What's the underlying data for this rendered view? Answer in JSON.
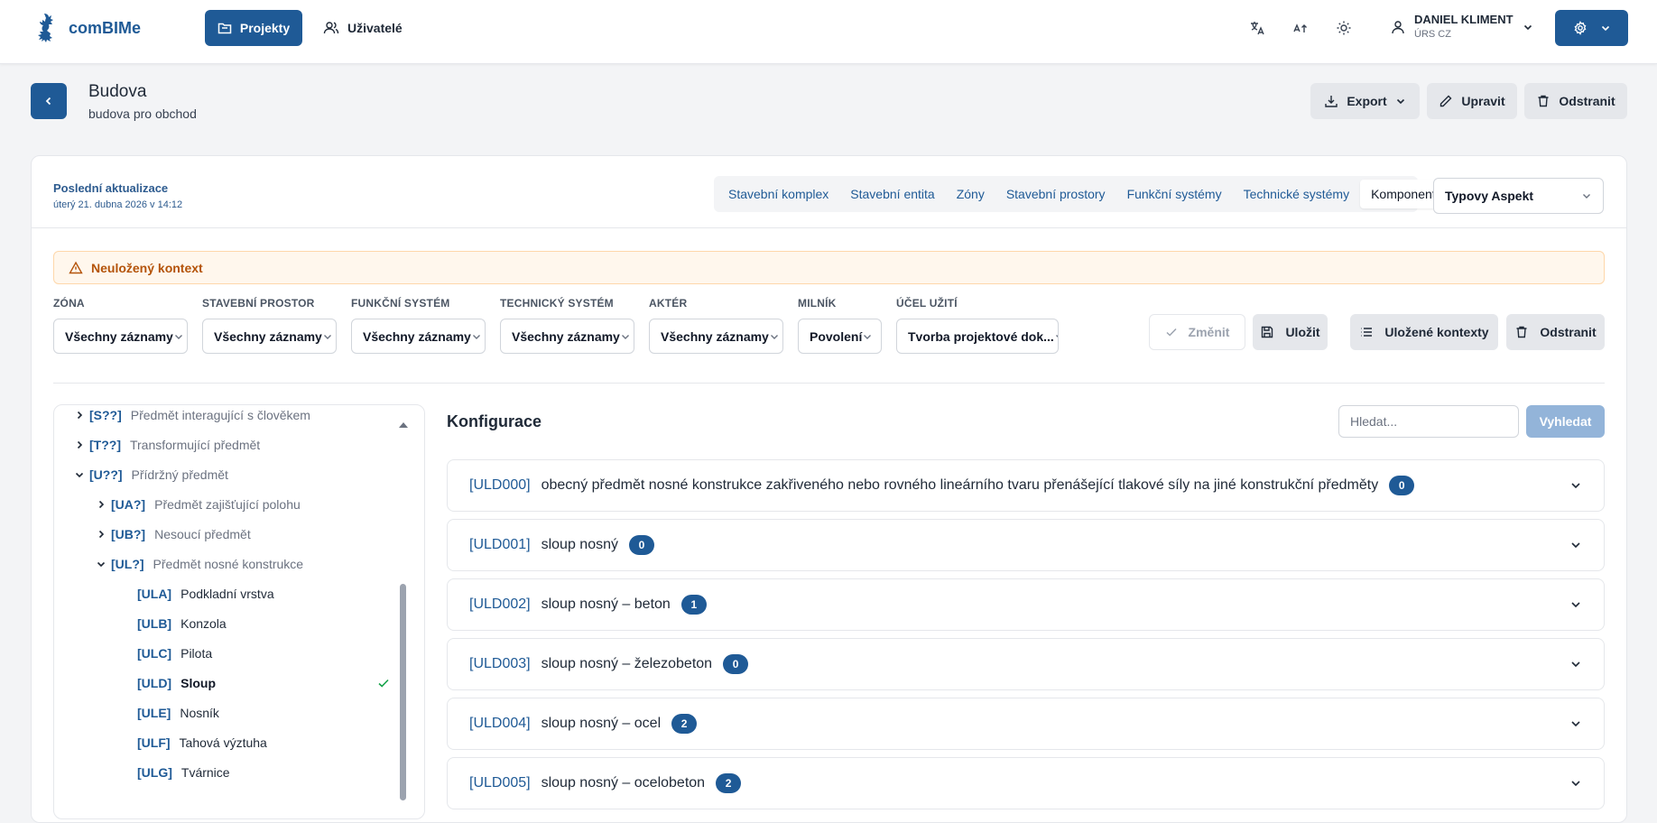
{
  "app": {
    "name": "comBIMe"
  },
  "nav": {
    "projects": "Projekty",
    "users": "Uživatelé"
  },
  "user": {
    "name": "DANIEL KLIMENT",
    "org": "ÚRS CZ"
  },
  "page": {
    "title": "Budova",
    "subtitle": "budova pro obchod"
  },
  "header_actions": {
    "export": "Export",
    "edit": "Upravit",
    "delete": "Odstranit"
  },
  "last_update": {
    "label": "Poslední aktualizace",
    "value": "úterý 21. dubna 2026 v 14:12"
  },
  "tabs": [
    {
      "label": "Stavební komplex"
    },
    {
      "label": "Stavební entita"
    },
    {
      "label": "Zóny"
    },
    {
      "label": "Stavební prostory"
    },
    {
      "label": "Funkční systémy"
    },
    {
      "label": "Technické systémy"
    },
    {
      "label": "Komponenty"
    }
  ],
  "active_tab": "Komponenty",
  "aspect_select": "Typovy Aspekt",
  "alert": "Neuložený kontext",
  "filters": [
    {
      "label": "ZÓNA",
      "value": "Všechny záznamy"
    },
    {
      "label": "STAVEBNÍ PROSTOR",
      "value": "Všechny záznamy"
    },
    {
      "label": "FUNKČNÍ SYSTÉM",
      "value": "Všechny záznamy"
    },
    {
      "label": "TECHNICKÝ SYSTÉM",
      "value": "Všechny záznamy"
    },
    {
      "label": "AKTÉR",
      "value": "Všechny záznamy"
    },
    {
      "label": "MILNÍK",
      "value": "Povolení"
    },
    {
      "label": "ÚČEL UŽITÍ",
      "value": "Tvorba projektové dok..."
    }
  ],
  "filter_actions": {
    "change": "Změnit",
    "save": "Uložit",
    "saved": "Uložené kontexty",
    "delete": "Odstranit"
  },
  "tree": [
    {
      "code": "[S??]",
      "label": "Předmět interagující s člověkem"
    },
    {
      "code": "[T??]",
      "label": "Transformující předmět"
    },
    {
      "code": "[U??]",
      "label": "Přídržný předmět"
    },
    {
      "code": "[UA?]",
      "label": "Předmět zajišťující polohu"
    },
    {
      "code": "[UB?]",
      "label": "Nesoucí předmět"
    },
    {
      "code": "[UL?]",
      "label": "Předmět nosné konstrukce"
    },
    {
      "code": "[ULA]",
      "label": "Podkladní vrstva"
    },
    {
      "code": "[ULB]",
      "label": "Konzola"
    },
    {
      "code": "[ULC]",
      "label": "Pilota"
    },
    {
      "code": "[ULD]",
      "label": "Sloup"
    },
    {
      "code": "[ULE]",
      "label": "Nosník"
    },
    {
      "code": "[ULF]",
      "label": "Tahová výztuha"
    },
    {
      "code": "[ULG]",
      "label": "Tvárnice"
    }
  ],
  "config": {
    "title": "Konfigurace",
    "search_placeholder": "Hledat...",
    "search_button": "Vyhledat",
    "items": [
      {
        "code": "[ULD000]",
        "title": "obecný předmět nosné konstrukce zakřiveného nebo rovného lineárního tvaru přenášející tlakové síly na jiné konstrukční předměty",
        "count": "0"
      },
      {
        "code": "[ULD001]",
        "title": "sloup nosný",
        "count": "0"
      },
      {
        "code": "[ULD002]",
        "title": "sloup nosný – beton",
        "count": "1"
      },
      {
        "code": "[ULD003]",
        "title": "sloup nosný – železobeton",
        "count": "0"
      },
      {
        "code": "[ULD004]",
        "title": "sloup nosný – ocel",
        "count": "2"
      },
      {
        "code": "[ULD005]",
        "title": "sloup nosný – ocelobeton",
        "count": "2"
      }
    ]
  },
  "colors": {
    "primary": "#1f5a96",
    "alert_bg": "#fff7ed",
    "alert_text": "#b45309",
    "success": "#16a34a"
  }
}
